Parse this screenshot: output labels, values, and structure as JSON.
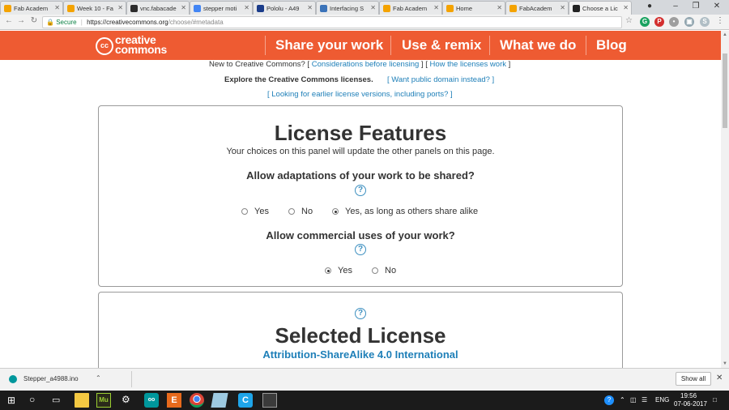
{
  "browser": {
    "tabs": [
      {
        "label": "Fab Academ",
        "icon_color": "#f4a300"
      },
      {
        "label": "Week 10 - Fa",
        "icon_color": "#f4a300"
      },
      {
        "label": "vnc.fabacade",
        "icon_color": "#2c2c2c"
      },
      {
        "label": "stepper moti",
        "icon_color": "#4285f4"
      },
      {
        "label": "Pololu - A49",
        "icon_color": "#1a3c8a"
      },
      {
        "label": "Interfacing S",
        "icon_color": "#3b73b9"
      },
      {
        "label": "Fab Academ",
        "icon_color": "#f4a300"
      },
      {
        "label": "Home",
        "icon_color": "#f4a300"
      },
      {
        "label": "FabAcadem",
        "icon_color": "#f4a300"
      },
      {
        "label": "Choose a Lic",
        "icon_color": "#222222"
      }
    ],
    "secure_label": "Secure",
    "url_host": "https://creativecommons.org",
    "url_path": "/choose/#metadata"
  },
  "site": {
    "logo_line1": "creative",
    "logo_line2": "commons",
    "logo_mark": "cc",
    "nav": [
      "Share your work",
      "Use & remix",
      "What we do",
      "Blog"
    ],
    "accent": "#ee5b32"
  },
  "intro": {
    "new_to_cc": "New to Creative Commons? [",
    "considerations_link": "Considerations before licensing",
    "mid_sep": "] [",
    "how_link": "How the licenses work",
    "end_bracket": "]",
    "explore": "Explore the Creative Commons licenses.",
    "public_domain_link": "[ Want public domain instead? ]",
    "earlier_versions_link": "[ Looking for earlier license versions, including ports? ]"
  },
  "features": {
    "title": "License Features",
    "subtitle": "Your choices on this panel will update the other panels on this page.",
    "q1": "Allow adaptations of your work to be shared?",
    "q1_options": [
      "Yes",
      "No",
      "Yes, as long as others share alike"
    ],
    "q1_selected": 2,
    "q2": "Allow commercial uses of your work?",
    "q2_options": [
      "Yes",
      "No"
    ],
    "q2_selected": 0,
    "help_glyph": "?"
  },
  "selected": {
    "title": "Selected License",
    "license_name": "Attribution-ShareAlike 4.0 International"
  },
  "downloads": {
    "file": "Stepper_a4988.ino",
    "show_all": "Show all"
  },
  "taskbar": {
    "time": "19:56",
    "date": "07-06-2017",
    "lang": "ENG"
  }
}
